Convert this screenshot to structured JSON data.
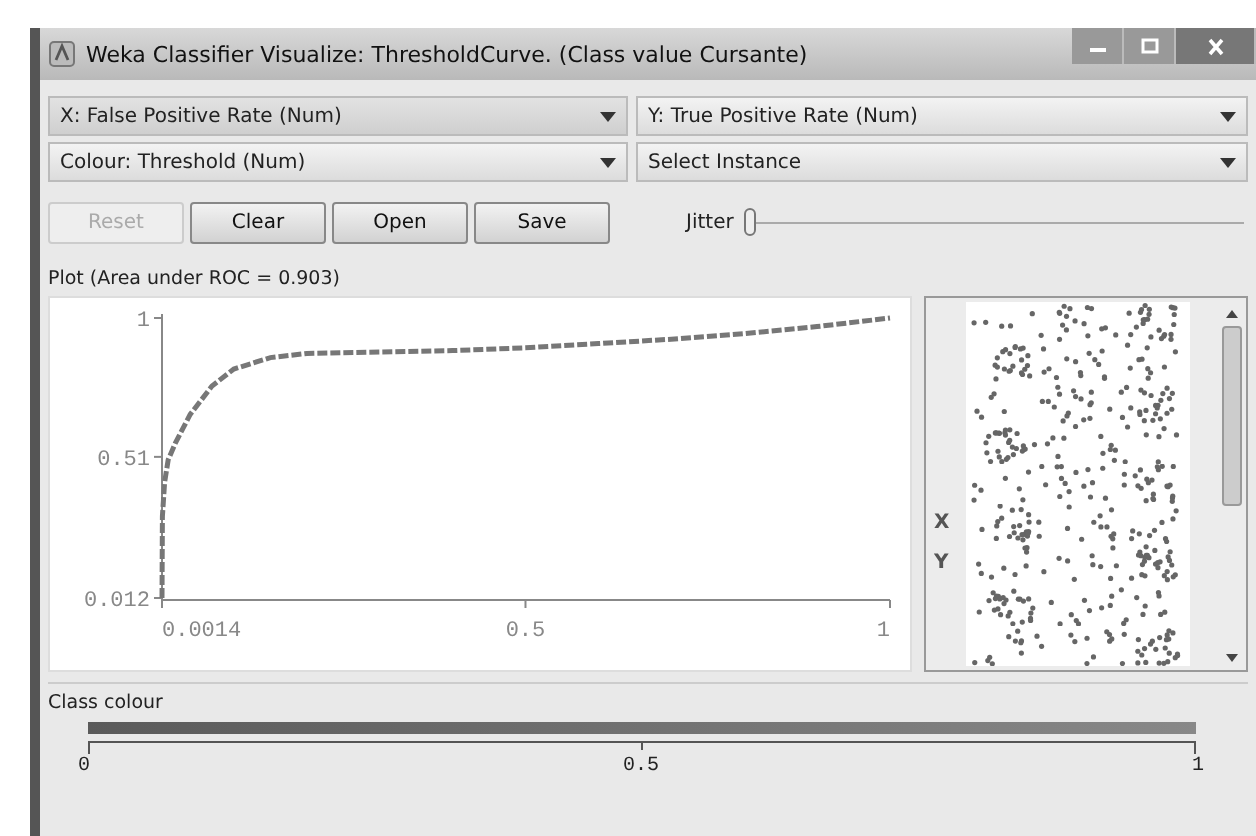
{
  "window": {
    "title": "Weka Classifier Visualize: ThresholdCurve. (Class value Cursante)"
  },
  "selectors": [
    {
      "text": "X: False Positive Rate (Num)"
    },
    {
      "text": "Y: True Positive Rate (Num)"
    },
    {
      "text": "Colour: Threshold (Num)"
    },
    {
      "text": "Select Instance"
    }
  ],
  "buttons": [
    {
      "label": "Reset",
      "disabled": true
    },
    {
      "label": "Clear",
      "disabled": false
    },
    {
      "label": "Open",
      "disabled": false
    },
    {
      "label": "Save",
      "disabled": false
    }
  ],
  "jitter": {
    "label": "Jitter",
    "level": 0
  },
  "plot": {
    "title": "Plot (Area under ROC = 0.903)",
    "chart_data": {
      "type": "line",
      "x": [
        0.0014,
        0.002,
        0.005,
        0.01,
        0.02,
        0.04,
        0.07,
        0.1,
        0.15,
        0.2,
        0.3,
        0.4,
        0.5,
        0.6,
        0.7,
        0.8,
        0.9,
        1
      ],
      "series": [
        {
          "color": "#777777",
          "line_style": "dashed",
          "values": [
            0.012,
            0.3,
            0.42,
            0.5,
            0.56,
            0.66,
            0.76,
            0.82,
            0.86,
            0.875,
            0.88,
            0.885,
            0.895,
            0.91,
            0.925,
            0.945,
            0.97,
            1
          ]
        }
      ],
      "xlim": [
        0.0014,
        1
      ],
      "ylim": [
        0.012,
        1
      ],
      "xticks": [
        0.0014,
        0.5,
        1
      ],
      "yticks": [
        0.012,
        0.51,
        1
      ]
    }
  },
  "attribute_panel": {
    "strips": [
      {
        "kind": "scatter"
      },
      {
        "kind": "scatter"
      },
      {
        "kind": "scatter"
      },
      {
        "kind": "scatter"
      },
      {
        "kind": "scatter"
      },
      {
        "kind": "scatter",
        "axis_marker": "X"
      },
      {
        "kind": "scatter",
        "axis_marker": "Y"
      },
      {
        "kind": "scatter"
      },
      {
        "kind": "scatter"
      }
    ]
  },
  "class_colour": {
    "title": "Class colour",
    "ticks": [
      "0",
      "0.5",
      "1"
    ]
  }
}
